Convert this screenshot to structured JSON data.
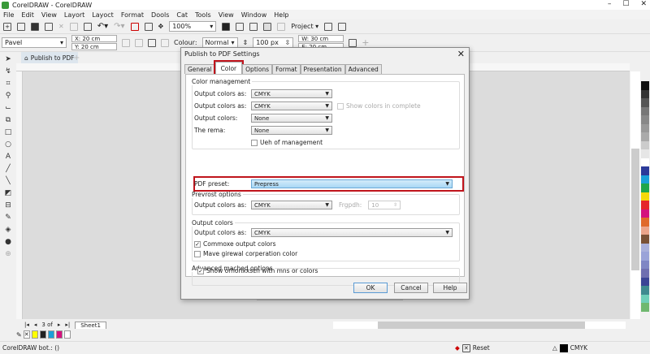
{
  "app": {
    "title": "CorelDRAW - CorelDRAW",
    "min": "–",
    "max": "☐",
    "close": "✕"
  },
  "menu": [
    "File",
    "Edit",
    "View",
    "Layort",
    "Layoct",
    "Format",
    "Dools",
    "Cat",
    "Tools",
    "View",
    "Window",
    "Help"
  ],
  "toolbar": {
    "zoom": "100%",
    "project": "Project"
  },
  "propbar": {
    "preset": "Pavel",
    "x": "X: 20 cm",
    "y": "Y: 20 cm",
    "colour_label": "Colour:",
    "colour": "Normal",
    "size": "100 px",
    "w": "W: 30 cm",
    "h": "E: 20 cm"
  },
  "doc_tab": "Publish to PDF",
  "sheet": {
    "page": "3 of",
    "tab": "Sheet1"
  },
  "status": {
    "left": "CorelDRAW bot.: ()",
    "reset": "Reset",
    "color_mode": "CMYK"
  },
  "palette": [
    "#111111",
    "#333333",
    "#555555",
    "#777777",
    "#888888",
    "#999999",
    "#aaaaaa",
    "#cccccc",
    "#e6e6e6",
    "#ffffff",
    "#2b3a9a",
    "#1aa0d8",
    "#1fa64b",
    "#f5d90a",
    "#e5262a",
    "#d4127e",
    "#e0692a",
    "#eba58a",
    "#7a5236",
    "#a9b0db",
    "#9aa3d8",
    "#7f86c4",
    "#6f6fb0",
    "#3b4495",
    "#3f8a8f",
    "#6fcfb8",
    "#6fb86f"
  ],
  "doc_palette": [
    "#ffff00",
    "#222222",
    "#1aa0d8",
    "#d4127e",
    "#ffffff"
  ],
  "dialog": {
    "title": "Publish to PDF Settings",
    "tabs": [
      "General",
      "Color",
      "Options",
      "Format",
      "Presentation",
      "Advanced"
    ],
    "active_tab": "Color",
    "color_management": {
      "legend": "Color management",
      "rows": [
        {
          "label": "Output colors as:",
          "value": "CMYK"
        },
        {
          "label": "Output colors as:",
          "value": "CMYK"
        },
        {
          "label": "Output colors:",
          "value": "None"
        },
        {
          "label": "The rema:",
          "value": "None"
        }
      ],
      "show_colors": "Show colors in complete",
      "use_mgmt": "Ueh of management"
    },
    "pdf_preset": {
      "label": "PDF preset:",
      "value": "Prepress"
    },
    "prevrost": {
      "legend": "Prevrost options",
      "label": "Output colors as:",
      "value": "CMYK",
      "fgpdh_label": "Frgpdh:",
      "fgpdh": "10"
    },
    "output_colors": {
      "legend": "Output colors",
      "label": "Output colors as:",
      "value": "CMYK",
      "check1": "Commoxe output colors",
      "check1_checked": true,
      "check2": "Mave girewal corperation color",
      "check2_checked": false
    },
    "advanced": {
      "legend": "Advanced mached options",
      "check": "Show orhonxxsch with mns or colors",
      "checked": true
    },
    "ok": "OK",
    "cancel": "Cancel",
    "help": "Help"
  }
}
